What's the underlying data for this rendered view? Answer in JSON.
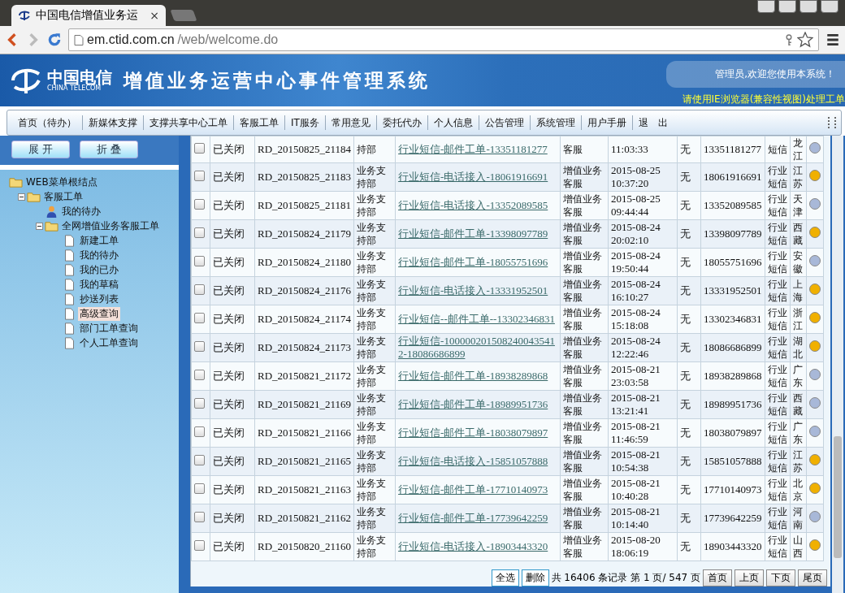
{
  "browser": {
    "tab_title": "中国电信增值业务运",
    "tab_close": "×",
    "url_host": "em.ctid.com.cn",
    "url_path": "/web/welcome.do"
  },
  "header": {
    "logo_cn": "中国电信",
    "logo_en": "CHINA TELECOM",
    "title": "增值业务运营中心事件管理系统",
    "welcome": "管理员,欢迎您使用本系统！",
    "notice": "请使用IE浏览器(兼容性视图)处理工单"
  },
  "nav": [
    "首页（待办）",
    "新媒体支撑",
    "支撑共享中心工单",
    "客服工单",
    "IT服务",
    "常用意见",
    "委托代办",
    "个人信息",
    "公告管理",
    "系统管理",
    "用户手册",
    "退　出"
  ],
  "sidebar": {
    "buttons": [
      "展 开",
      "折 叠"
    ],
    "tree": [
      {
        "label": "WEB菜单根结点",
        "kind": "folder",
        "children": [
          {
            "label": "客服工单",
            "kind": "folder",
            "expanded": true,
            "children": [
              {
                "label": "我的待办",
                "kind": "person",
                "selected": false
              },
              {
                "label": "全网增值业务客服工单",
                "kind": "folder",
                "expanded": true,
                "children": [
                  {
                    "label": "新建工单",
                    "kind": "page",
                    "selected": false
                  },
                  {
                    "label": "我的待办",
                    "kind": "page",
                    "selected": false
                  },
                  {
                    "label": "我的已办",
                    "kind": "page",
                    "selected": false
                  },
                  {
                    "label": "我的草稿",
                    "kind": "page",
                    "selected": false
                  },
                  {
                    "label": "抄送列表",
                    "kind": "page",
                    "selected": false
                  },
                  {
                    "label": "高级查询",
                    "kind": "page",
                    "selected": true
                  },
                  {
                    "label": "部门工单查询",
                    "kind": "page",
                    "selected": false
                  },
                  {
                    "label": "个人工单查询",
                    "kind": "page",
                    "selected": false
                  }
                ]
              }
            ]
          }
        ]
      }
    ]
  },
  "table": {
    "rows": [
      {
        "checked": false,
        "status": "已关闭",
        "id": "RD_20150825_21184",
        "dept": "持部",
        "title": "行业短信-邮件工单-13351181277",
        "type": "客服",
        "time": "11:03:33",
        "flag": "无",
        "phone": "13351181277",
        "category": "短信",
        "province": "龙江",
        "color": "#a8b8d8"
      },
      {
        "checked": false,
        "status": "已关闭",
        "id": "RD_20150825_21183",
        "dept": "业务支持部",
        "title": "行业短信-电话接入-18061916691",
        "type": "增值业务客服",
        "date": "2015-08-25",
        "time": "10:37:20",
        "flag": "无",
        "phone": "18061916691",
        "category": "行业短信",
        "province": "江苏",
        "color": "#f0b000"
      },
      {
        "checked": false,
        "status": "已关闭",
        "id": "RD_20150825_21181",
        "dept": "业务支持部",
        "title": "行业短信-电话接入-13352089585",
        "type": "增值业务客服",
        "date": "2015-08-25",
        "time": "09:44:44",
        "flag": "无",
        "phone": "13352089585",
        "category": "行业短信",
        "province": "天津",
        "color": "#a8b8d8"
      },
      {
        "checked": false,
        "status": "已关闭",
        "id": "RD_20150824_21179",
        "dept": "业务支持部",
        "title": "行业短信-邮件工单-13398097789",
        "type": "增值业务客服",
        "date": "2015-08-24",
        "time": "20:02:10",
        "flag": "无",
        "phone": "13398097789",
        "category": "行业短信",
        "province": "西藏",
        "color": "#f0b000"
      },
      {
        "checked": false,
        "status": "已关闭",
        "id": "RD_20150824_21180",
        "dept": "业务支持部",
        "title": "行业短信-邮件工单-18055751696",
        "type": "增值业务客服",
        "date": "2015-08-24",
        "time": "19:50:44",
        "flag": "无",
        "phone": "18055751696",
        "category": "行业短信",
        "province": "安徽",
        "color": "#a8b8d8"
      },
      {
        "checked": false,
        "status": "已关闭",
        "id": "RD_20150824_21176",
        "dept": "业务支持部",
        "title": "行业短信-电话接入-13331952501",
        "type": "增值业务客服",
        "date": "2015-08-24",
        "time": "16:10:27",
        "flag": "无",
        "phone": "13331952501",
        "category": "行业短信",
        "province": "上海",
        "color": "#f0b000"
      },
      {
        "checked": false,
        "status": "已关闭",
        "id": "RD_20150824_21174",
        "dept": "业务支持部",
        "title": "行业短信--邮件工单--13302346831",
        "type": "增值业务客服",
        "date": "2015-08-24",
        "time": "15:18:08",
        "flag": "无",
        "phone": "13302346831",
        "category": "行业短信",
        "province": "浙江",
        "color": "#f0b000"
      },
      {
        "checked": false,
        "status": "已关闭",
        "id": "RD_20150824_21173",
        "dept": "业务支持部",
        "title": "行业短信-1000002015082400435412-18086686899",
        "type": "增值业务客服",
        "date": "2015-08-24",
        "time": "12:22:46",
        "flag": "无",
        "phone": "18086686899",
        "category": "行业短信",
        "province": "湖北",
        "color": "#f0b000"
      },
      {
        "checked": false,
        "status": "已关闭",
        "id": "RD_20150821_21172",
        "dept": "业务支持部",
        "title": "行业短信-邮件工单-18938289868",
        "type": "增值业务客服",
        "date": "2015-08-21",
        "time": "23:03:58",
        "flag": "无",
        "phone": "18938289868",
        "category": "行业短信",
        "province": "广东",
        "color": "#a8b8d8"
      },
      {
        "checked": false,
        "status": "已关闭",
        "id": "RD_20150821_21169",
        "dept": "业务支持部",
        "title": "行业短信-邮件工单-18989951736",
        "type": "增值业务客服",
        "date": "2015-08-21",
        "time": "13:21:41",
        "flag": "无",
        "phone": "18989951736",
        "category": "行业短信",
        "province": "西藏",
        "color": "#a8b8d8"
      },
      {
        "checked": false,
        "status": "已关闭",
        "id": "RD_20150821_21166",
        "dept": "业务支持部",
        "title": "行业短信-邮件工单-18038079897",
        "type": "增值业务客服",
        "date": "2015-08-21",
        "time": "11:46:59",
        "flag": "无",
        "phone": "18038079897",
        "category": "行业短信",
        "province": "广东",
        "color": "#a8b8d8"
      },
      {
        "checked": false,
        "status": "已关闭",
        "id": "RD_20150821_21165",
        "dept": "业务支持部",
        "title": "行业短信-电话接入-15851057888",
        "type": "增值业务客服",
        "date": "2015-08-21",
        "time": "10:54:38",
        "flag": "无",
        "phone": "15851057888",
        "category": "行业短信",
        "province": "江苏",
        "color": "#f0b000"
      },
      {
        "checked": false,
        "status": "已关闭",
        "id": "RD_20150821_21163",
        "dept": "业务支持部",
        "title": "行业短信-邮件工单-17710140973",
        "type": "增值业务客服",
        "date": "2015-08-21",
        "time": "10:40:28",
        "flag": "无",
        "phone": "17710140973",
        "category": "行业短信",
        "province": "北京",
        "color": "#f0b000"
      },
      {
        "checked": false,
        "status": "已关闭",
        "id": "RD_20150821_21162",
        "dept": "业务支持部",
        "title": "行业短信-邮件工单-17739642259",
        "type": "增值业务客服",
        "date": "2015-08-21",
        "time": "10:14:40",
        "flag": "无",
        "phone": "17739642259",
        "category": "行业短信",
        "province": "河南",
        "color": "#a8b8d8"
      },
      {
        "checked": false,
        "status": "已关闭",
        "id": "RD_20150820_21160",
        "dept": "业务支持部",
        "title": "行业短信-电话接入-18903443320",
        "type": "增值业务客服",
        "date": "2015-08-20",
        "time": "18:06:19",
        "flag": "无",
        "phone": "18903443320",
        "category": "行业短信",
        "province": "山西",
        "color": "#f0b000"
      }
    ]
  },
  "pager": {
    "buttons": [
      "全选",
      "删除"
    ],
    "summary": "共 16406 条记录 第 1 页/ 547 页",
    "pages": [
      "首页",
      "上页",
      "下页",
      "尾页"
    ]
  }
}
